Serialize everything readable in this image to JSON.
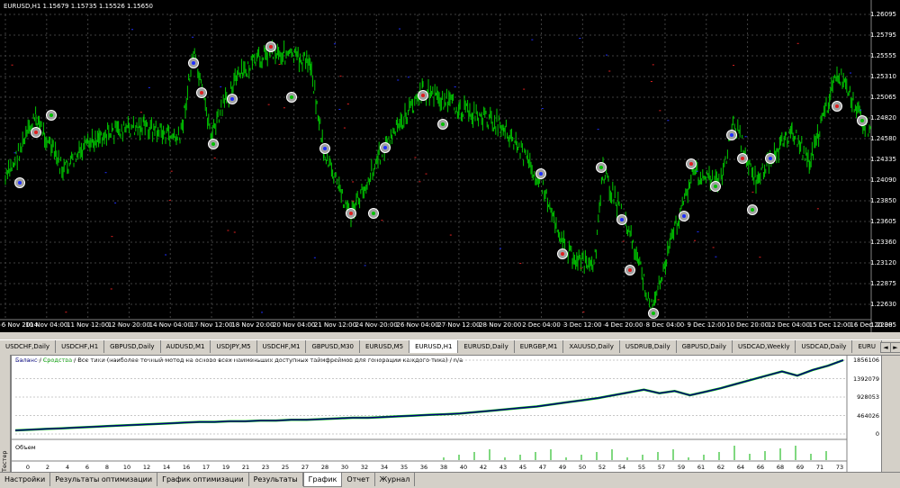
{
  "chart": {
    "title": "EURUSD,H1  1.15679  1.15735  1.15526  1.15650",
    "price_ticks": [
      "1.26095",
      "1.25795",
      "1.25555",
      "1.25310",
      "1.25065",
      "1.24820",
      "1.24580",
      "1.24335",
      "1.24090",
      "1.23850",
      "1.23605",
      "1.23360",
      "1.23120",
      "1.22875",
      "1.22630",
      "1.22385"
    ],
    "time_ticks": [
      "6 Nov 2014",
      "10 Nov 04:00",
      "11 Nov 12:00",
      "12 Nov 20:00",
      "14 Nov 04:00",
      "17 Nov 12:00",
      "18 Nov 20:00",
      "20 Nov 04:00",
      "21 Nov 12:00",
      "24 Nov 20:00",
      "26 Nov 04:00",
      "27 Nov 12:00",
      "28 Nov 20:00",
      "2 Dec 04:00",
      "3 Dec 12:00",
      "4 Dec 20:00",
      "8 Dec 04:00",
      "9 Dec 12:00",
      "10 Dec 20:00",
      "12 Dec 04:00",
      "15 Dec 12:00",
      "16 Dec 20:00"
    ],
    "colors": {
      "background": "#000000",
      "candles": "#00c800",
      "grid": "#404040",
      "text": "#ffffff"
    }
  },
  "symbol_tabs": [
    "USDCHF,Daily",
    "USDCHF,H1",
    "GBPUSD,Daily",
    "AUDUSD,M1",
    "USDJPY,M5",
    "USDCHF,M1",
    "GBPUSD,M30",
    "EURUSD,M5",
    "EURUSD,H1",
    "EURUSD,Daily",
    "EURGBP,M1",
    "XAUUSD,Daily",
    "USDRUB,Daily",
    "GBPUSD,Daily",
    "USDCAD,Weekly",
    "USDCAD,Daily",
    "EURU"
  ],
  "report": {
    "title_balance": "Баланс",
    "title_equity": "Средства",
    "title_rest": "/ Все тики (наиболее точный метод на основе всех наименьших доступных таймфреймов для генерации каждого тика) / n/a",
    "value_ticks": [
      "1856106",
      "1392079",
      "928053",
      "464026",
      "0"
    ],
    "volume_label": "Объем",
    "trade_ticks": [
      "0",
      "2",
      "4",
      "6",
      "8",
      "10",
      "12",
      "14",
      "16",
      "17",
      "19",
      "21",
      "23",
      "25",
      "27",
      "28",
      "30",
      "32",
      "34",
      "35",
      "36",
      "38",
      "40",
      "42",
      "43",
      "45",
      "47",
      "49",
      "50",
      "52",
      "54",
      "55",
      "57",
      "59",
      "61",
      "62",
      "64",
      "66",
      "68",
      "69",
      "71",
      "73"
    ],
    "balance_series": [
      0.0,
      0.01,
      0.02,
      0.03,
      0.04,
      0.05,
      0.06,
      0.07,
      0.08,
      0.09,
      0.1,
      0.11,
      0.12,
      0.12,
      0.13,
      0.13,
      0.14,
      0.14,
      0.15,
      0.15,
      0.16,
      0.17,
      0.18,
      0.18,
      0.19,
      0.2,
      0.21,
      0.22,
      0.23,
      0.24,
      0.26,
      0.28,
      0.3,
      0.32,
      0.34,
      0.37,
      0.4,
      0.43,
      0.46,
      0.5,
      0.54,
      0.58,
      0.53,
      0.56,
      0.5,
      0.55,
      0.6,
      0.66,
      0.72,
      0.78,
      0.84,
      0.78,
      0.86,
      0.92,
      1.0
    ],
    "colors": {
      "balance": "#000080",
      "equity": "#00c000"
    }
  },
  "sidebar_label": "Тестер",
  "bottom_tabs": [
    "Настройки",
    "Результаты оптимизации",
    "График оптимизации",
    "Результаты",
    "График",
    "Отчет",
    "Журнал"
  ],
  "active_bottom_tab": "График"
}
